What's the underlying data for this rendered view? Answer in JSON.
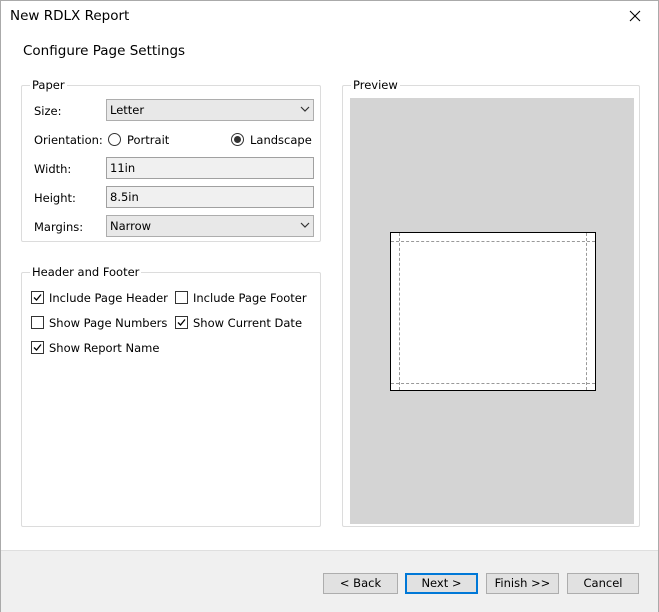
{
  "window": {
    "title": "New RDLX Report"
  },
  "page": {
    "title": "Configure Page Settings"
  },
  "paper": {
    "group_label": "Paper",
    "size_label": "Size:",
    "size_value": "Letter",
    "orientation_label": "Orientation:",
    "orientation_options": [
      {
        "label": "Portrait",
        "selected": false
      },
      {
        "label": "Landscape",
        "selected": true
      }
    ],
    "width_label": "Width:",
    "width_value": "11in",
    "height_label": "Height:",
    "height_value": "8.5in",
    "margins_label": "Margins:",
    "margins_value": "Narrow"
  },
  "header_footer": {
    "group_label": "Header and Footer",
    "options": [
      {
        "label": "Include Page Header",
        "checked": true
      },
      {
        "label": "Include Page Footer",
        "checked": false
      },
      {
        "label": "Show Page Numbers",
        "checked": false
      },
      {
        "label": "Show Current Date",
        "checked": true
      },
      {
        "label": "Show Report Name",
        "checked": true
      }
    ]
  },
  "preview": {
    "group_label": "Preview"
  },
  "buttons": {
    "back": "< Back",
    "next": "Next >",
    "finish": "Finish >>",
    "cancel": "Cancel"
  },
  "icons": {
    "close": "close-icon",
    "dropdown": "chevron-down-icon",
    "check": "checkmark-icon"
  },
  "colors": {
    "default_button_border": "#0078d7",
    "preview_background": "#d4d4d4"
  }
}
